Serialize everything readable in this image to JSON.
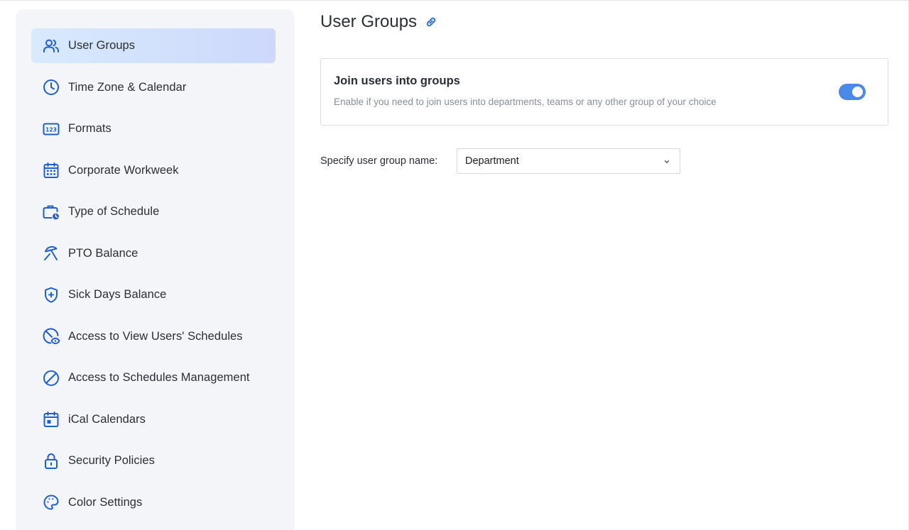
{
  "colors": {
    "accent": "#1f5fd6",
    "toggle_on": "#4a89e8",
    "sidebar_bg": "#f4f5f8",
    "active_item_start": "#d8eafd",
    "active_item_end": "#cdd8fb"
  },
  "sidebar": {
    "items": [
      {
        "label": "User Groups",
        "icon": "users-icon",
        "active": true
      },
      {
        "label": "Time Zone & Calendar",
        "icon": "clock-icon",
        "active": false
      },
      {
        "label": "Formats",
        "icon": "number-format-icon",
        "active": false
      },
      {
        "label": "Corporate Workweek",
        "icon": "calendar-grid-icon",
        "active": false
      },
      {
        "label": "Type of Schedule",
        "icon": "briefcase-clock-icon",
        "active": false
      },
      {
        "label": "PTO Balance",
        "icon": "beach-umbrella-icon",
        "active": false
      },
      {
        "label": "Sick Days Balance",
        "icon": "medical-shield-icon",
        "active": false
      },
      {
        "label": "Access to View Users' Schedules",
        "icon": "view-access-icon",
        "active": false
      },
      {
        "label": "Access to Schedules Management",
        "icon": "forbidden-icon",
        "active": false
      },
      {
        "label": "iCal Calendars",
        "icon": "calendar-icon",
        "active": false
      },
      {
        "label": "Security Policies",
        "icon": "lock-icon",
        "active": false
      },
      {
        "label": "Color Settings",
        "icon": "palette-icon",
        "active": false
      }
    ]
  },
  "main": {
    "title": "User Groups",
    "title_icon": "link-icon",
    "card": {
      "title": "Join users into groups",
      "description": "Enable if you need to join users into departments, teams or any other group of your choice",
      "toggle_on": true
    },
    "group_name_field": {
      "label": "Specify user group name:",
      "value": "Department"
    }
  }
}
